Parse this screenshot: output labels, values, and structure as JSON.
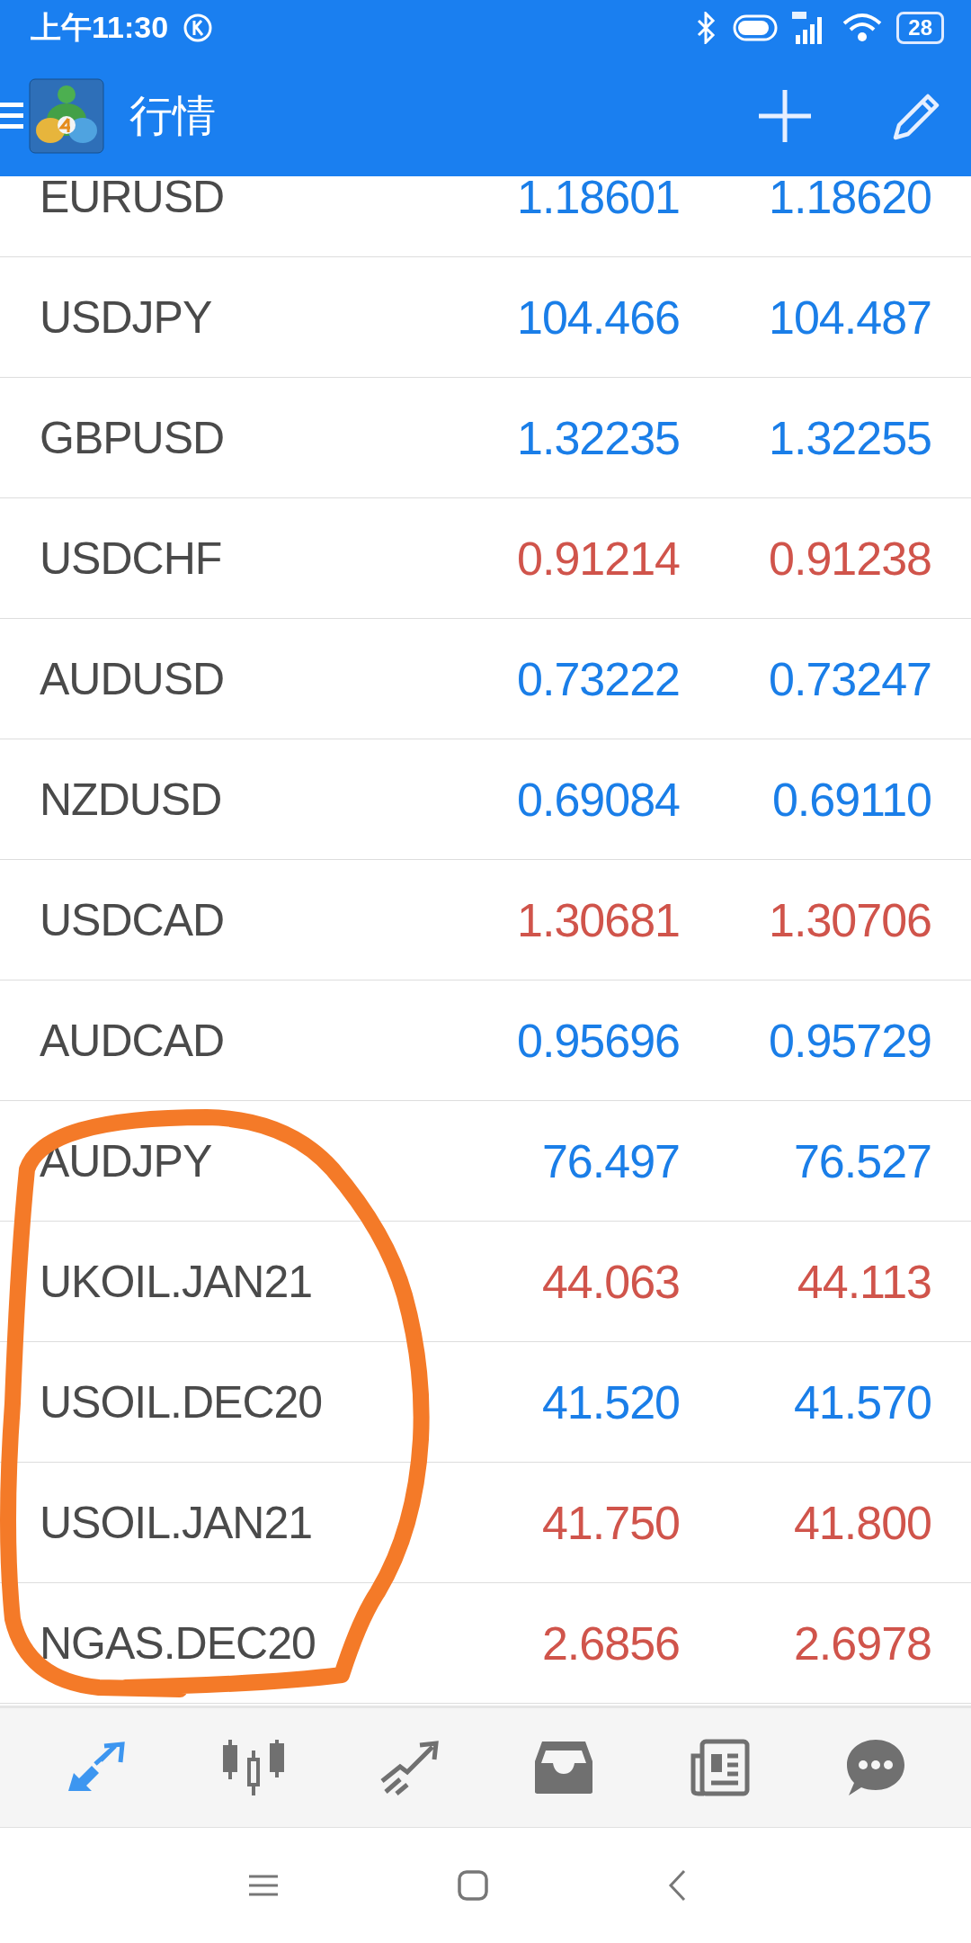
{
  "status_bar": {
    "time": "上午11:30",
    "battery": "28"
  },
  "header": {
    "title": "行情"
  },
  "quotes": [
    {
      "symbol": "EURUSD",
      "bid": "1.18601",
      "ask": "1.18620",
      "color": "#1a7ee8"
    },
    {
      "symbol": "USDJPY",
      "bid": "104.466",
      "ask": "104.487",
      "color": "#1a7ee8"
    },
    {
      "symbol": "GBPUSD",
      "bid": "1.32235",
      "ask": "1.32255",
      "color": "#1a7ee8"
    },
    {
      "symbol": "USDCHF",
      "bid": "0.91214",
      "ask": "0.91238",
      "color": "#d0544b"
    },
    {
      "symbol": "AUDUSD",
      "bid": "0.73222",
      "ask": "0.73247",
      "color": "#1a7ee8"
    },
    {
      "symbol": "NZDUSD",
      "bid": "0.69084",
      "ask": "0.69110",
      "color": "#1a7ee8"
    },
    {
      "symbol": "USDCAD",
      "bid": "1.30681",
      "ask": "1.30706",
      "color": "#d0544b"
    },
    {
      "symbol": "AUDCAD",
      "bid": "0.95696",
      "ask": "0.95729",
      "color": "#1a7ee8"
    },
    {
      "symbol": "AUDJPY",
      "bid": "76.497",
      "ask": "76.527",
      "color": "#1a7ee8"
    },
    {
      "symbol": "UKOIL.JAN21",
      "bid": "44.063",
      "ask": "44.113",
      "color": "#d0544b"
    },
    {
      "symbol": "USOIL.DEC20",
      "bid": "41.520",
      "ask": "41.570",
      "color": "#1a7ee8"
    },
    {
      "symbol": "USOIL.JAN21",
      "bid": "41.750",
      "ask": "41.800",
      "color": "#d0544b"
    },
    {
      "symbol": "NGAS.DEC20",
      "bid": "2.6856",
      "ask": "2.6978",
      "color": "#d0544b"
    }
  ],
  "bottom_nav": [
    {
      "selected": true
    },
    {
      "selected": false
    },
    {
      "selected": false
    },
    {
      "selected": false
    },
    {
      "selected": false
    },
    {
      "selected": false
    }
  ]
}
